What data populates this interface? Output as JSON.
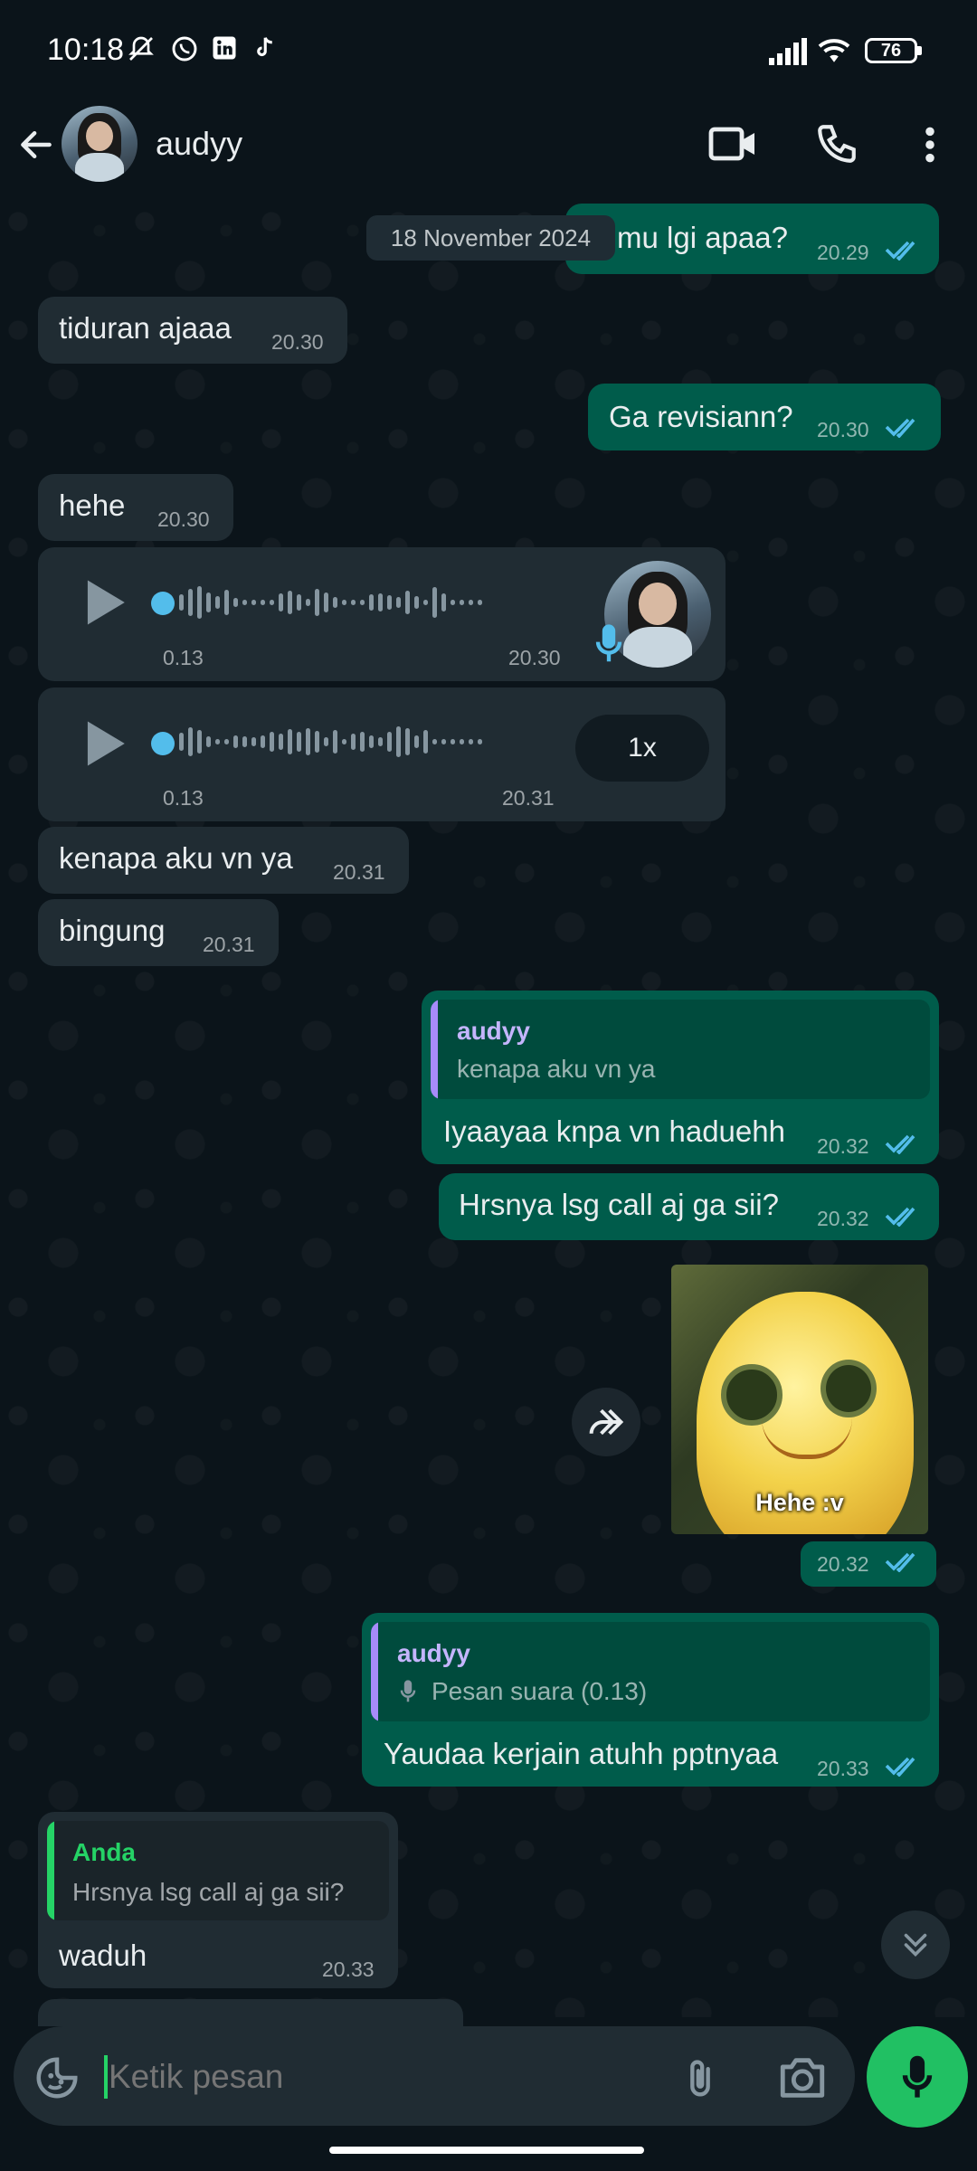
{
  "status_bar": {
    "time": "10:18",
    "battery": "76"
  },
  "header": {
    "contact_name": "audyy"
  },
  "chat": {
    "date_chip": "18 November 2024",
    "messages": [
      {
        "dir": "out",
        "text": "mu lgi apaa?",
        "time": "20.29"
      },
      {
        "dir": "in",
        "text": "tiduran ajaaa",
        "time": "20.30"
      },
      {
        "dir": "out",
        "text": "Ga revisiann?",
        "time": "20.30"
      },
      {
        "dir": "in",
        "text": "hehe",
        "time": "20.30"
      },
      {
        "dir": "in",
        "type": "voice",
        "duration": "0.13",
        "time": "20.30"
      },
      {
        "dir": "in",
        "type": "voice",
        "duration": "0.13",
        "time": "20.31",
        "speed": "1x"
      },
      {
        "dir": "in",
        "text": "kenapa aku vn ya",
        "time": "20.31"
      },
      {
        "dir": "in",
        "text": "bingung",
        "time": "20.31"
      },
      {
        "dir": "out",
        "quote_name": "audyy",
        "quote_text": "kenapa aku vn ya",
        "text": "Iyaayaa knpa vn haduehh",
        "time": "20.32"
      },
      {
        "dir": "out",
        "text": "Hrsnya lsg call aj ga sii?",
        "time": "20.32"
      },
      {
        "dir": "out",
        "type": "sticker",
        "caption": "Hehe :v",
        "time": "20.32"
      },
      {
        "dir": "out",
        "quote_name": "audyy",
        "quote_text": "Pesan suara (0.13)",
        "text": "Yaudaa kerjain atuhh pptnyaa",
        "time": "20.33"
      },
      {
        "dir": "in",
        "quote_name": "Anda",
        "quote_text": "Hrsnya lsg call aj ga sii?",
        "text": "waduh",
        "time": "20.33"
      }
    ]
  },
  "composer": {
    "placeholder": "Ketik pesan"
  },
  "colors": {
    "incoming_bubble": "#202c33",
    "outgoing_bubble": "#005c4b",
    "accent_green": "#21c063",
    "read_tick": "#53bdeb",
    "quote_bar_purple": "#a78bfa",
    "quote_bar_green": "#25d366"
  }
}
